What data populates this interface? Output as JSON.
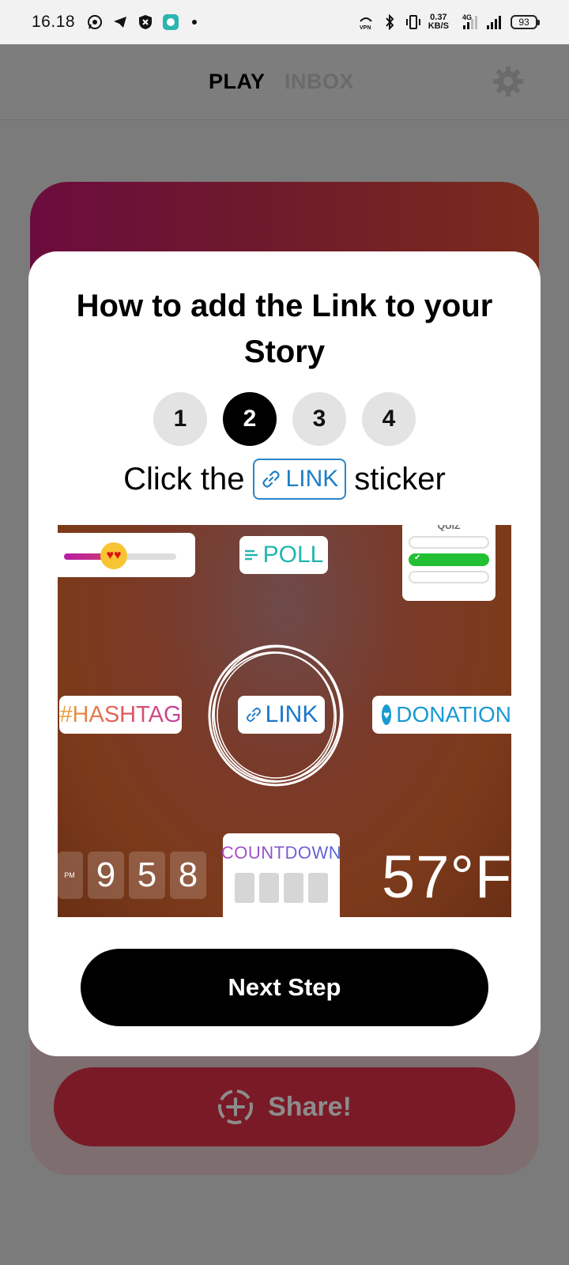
{
  "status_bar": {
    "time": "16.18",
    "speed_value": "0.37",
    "speed_unit": "KB/S",
    "network": "4G",
    "battery": "93",
    "icons_left": [
      "whatsapp-icon",
      "telegram-icon",
      "shield-icon",
      "chat-icon"
    ],
    "icons_right": [
      "vpn-icon",
      "bluetooth-icon",
      "vibrate-icon",
      "signal-icon",
      "signal-icon-2",
      "battery-icon"
    ]
  },
  "header": {
    "tab_play": "PLAY",
    "tab_inbox": "INBOX",
    "settings_icon": "gear-icon"
  },
  "modal": {
    "title": "How to add the Link to your Story",
    "steps": [
      "1",
      "2",
      "3",
      "4"
    ],
    "active_step": "2",
    "instruction_prefix": "Click the",
    "instruction_chip": "LINK",
    "instruction_suffix": "sticker",
    "next_button": "Next Step"
  },
  "sticker_image": {
    "poll": "POLL",
    "quiz": "QUIZ",
    "hashtag": "#HASHTAG",
    "link": "LINK",
    "donation": "DONATION",
    "countdown": "COUNTDOWN",
    "time_pm": "PM",
    "time_digits": [
      "9",
      "5",
      "8"
    ],
    "temperature": "57°F"
  },
  "background": {
    "share_button": "Share!"
  },
  "colors": {
    "accent_black": "#000000",
    "link_blue": "#1f7fc4",
    "share_red": "#7a1a27"
  }
}
